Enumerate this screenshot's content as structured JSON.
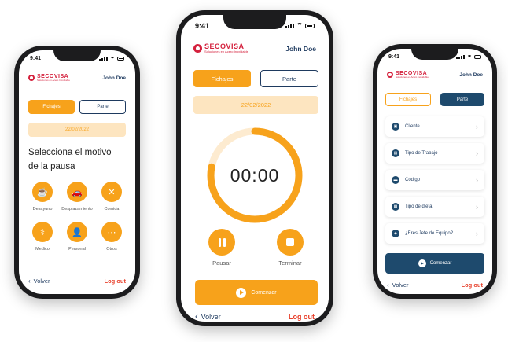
{
  "status": {
    "time": "9:41"
  },
  "brand": {
    "name": "SECOVISA",
    "tagline": "Soluciones en Acero Inoxidable",
    "primary_color": "#f7a21b",
    "navy_color": "#1e4a6d",
    "red_color": "#d4213d"
  },
  "user": {
    "name": "John Doe"
  },
  "tabs": {
    "fichajes": "Fichajes",
    "parte": "Parte"
  },
  "date": "22/02/2022",
  "left": {
    "heading": "Selecciona el motivo de la pausa",
    "options": [
      {
        "label": "Desayuno",
        "icon": "breakfast-icon"
      },
      {
        "label": "Desplazamiento",
        "icon": "car-icon"
      },
      {
        "label": "Comida",
        "icon": "cutlery-icon"
      },
      {
        "label": "Medico",
        "icon": "doctor-icon"
      },
      {
        "label": "Personal",
        "icon": "person-icon"
      },
      {
        "label": "Otros",
        "icon": "more-icon"
      }
    ]
  },
  "center": {
    "timer": "00:00",
    "timer_progress": 0.78,
    "pause_label": "Pausar",
    "stop_label": "Terminar",
    "start_label": "Comenzar"
  },
  "right": {
    "rows": [
      {
        "label": "Cliente",
        "icon": "client-icon"
      },
      {
        "label": "Tipo de Trabajo",
        "icon": "briefcase-icon"
      },
      {
        "label": "Código",
        "icon": "code-icon"
      },
      {
        "label": "Tipo de dieta",
        "icon": "document-icon"
      },
      {
        "label": "¿Eres Jefe de Equipo?",
        "icon": "team-icon"
      }
    ],
    "start_label": "Comenzar"
  },
  "nav": {
    "back": "Volver",
    "logout": "Log out"
  }
}
